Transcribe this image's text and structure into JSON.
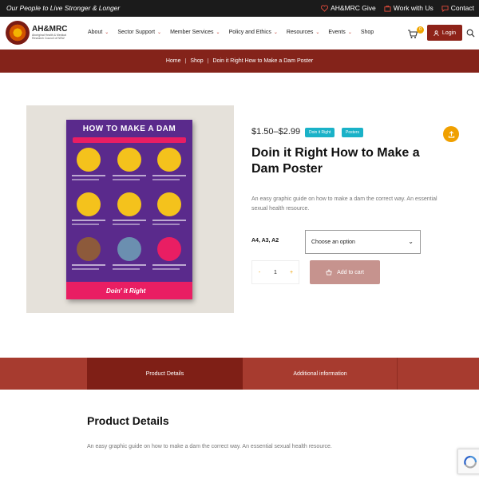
{
  "topbar": {
    "tagline": "Our People to Live Stronger & Longer",
    "links": [
      {
        "label": "AH&MRC Give",
        "icon": "heart-icon"
      },
      {
        "label": "Work with Us",
        "icon": "briefcase-icon"
      },
      {
        "label": "Contact",
        "icon": "chat-icon"
      }
    ]
  },
  "header": {
    "brand": "AH&MRC",
    "brand_sub": "Aboriginal Health & Medical Research Council of NSW",
    "nav": [
      {
        "label": "About"
      },
      {
        "label": "Sector Support"
      },
      {
        "label": "Member Services"
      },
      {
        "label": "Policy and Ethics"
      },
      {
        "label": "Resources"
      },
      {
        "label": "Events"
      },
      {
        "label": "Shop"
      }
    ],
    "cart_count": "0",
    "login_label": "Login"
  },
  "breadcrumb": {
    "items": [
      "Home",
      "Shop",
      "Doin it Right How to Make a Dam Poster"
    ],
    "separator": "|"
  },
  "product": {
    "poster_title": "HOW TO MAKE A DAM",
    "poster_footer": "Doin' it Right",
    "price": "$1.50–$2.99",
    "categories": [
      "Doin it Right",
      "Posters"
    ],
    "title": "Doin it Right How to Make a Dam Poster",
    "short_description": "An easy graphic guide on how to make a dam the correct way. An essential sexual health resource.",
    "variation_label": "A4, A3, A2",
    "variation_placeholder": "Choose an option",
    "quantity": "1",
    "qty_minus": "-",
    "qty_plus": "+",
    "add_to_cart": "Add to cart"
  },
  "tabs": {
    "details": "Product Details",
    "additional": "Additional information"
  },
  "details": {
    "heading": "Product Details",
    "text": "An easy graphic guide on how to make a dam the correct way. An essential sexual health resource."
  },
  "colors": {
    "brand_dark": "#84231a",
    "accent_orange": "#f0a000",
    "badge_blue": "#1ab2c8",
    "add_to_cart": "#c6938e"
  }
}
